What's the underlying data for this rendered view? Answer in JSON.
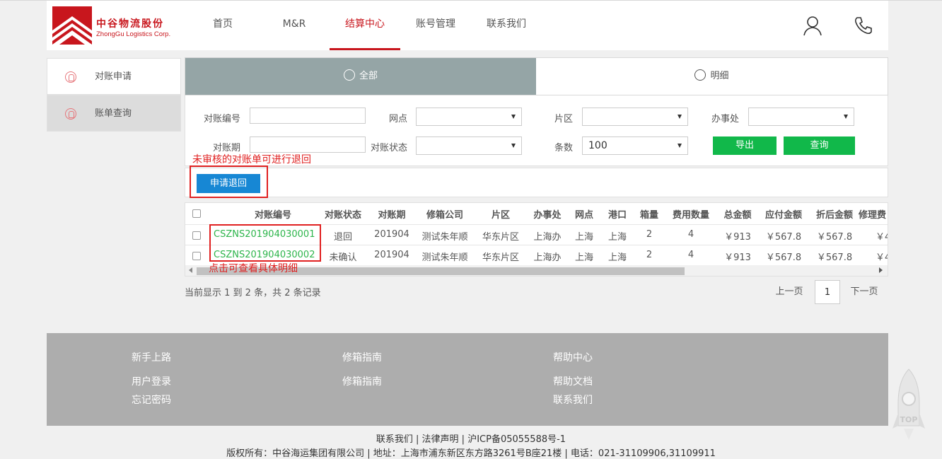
{
  "header": {
    "logo_cn": "中谷物流股份",
    "logo_en": "ZhongGu Logistics Corp.",
    "nav": [
      "首页",
      "M&R",
      "结算中心",
      "账号管理",
      "联系我们"
    ],
    "active_nav": "结算中心"
  },
  "sidebar": {
    "items": [
      {
        "label": "对账申请"
      },
      {
        "label": "账单查询"
      }
    ]
  },
  "tabs": {
    "all": "全部",
    "detail": "明细"
  },
  "filter": {
    "recon_no_label": "对账编号",
    "outlet_label": "网点",
    "area_label": "片区",
    "office_label": "办事处",
    "period_label": "对账期",
    "status_label": "对账状态",
    "rows_label": "条数",
    "rows_value": "100",
    "export_btn": "导出",
    "query_btn": "查询"
  },
  "annotations": {
    "return_note": "未审核的对账单可进行退回",
    "click_note": "点击可查看具体明细"
  },
  "actions": {
    "apply_return": "申请退回"
  },
  "table": {
    "headers": [
      "对账编号",
      "对账状态",
      "对账期",
      "修箱公司",
      "片区",
      "办事处",
      "网点",
      "港口",
      "箱量",
      "费用数量",
      "总金额",
      "应付金额",
      "折后金额",
      "修理费"
    ],
    "rows": [
      [
        "CSZNS201904030001",
        "退回",
        "201904",
        "测试朱年顺",
        "华东片区",
        "上海办",
        "上海",
        "上海",
        "2",
        "4",
        "￥913",
        "￥567.8",
        "￥567.8",
        "￥4"
      ],
      [
        "CSZNS201904030002",
        "未确认",
        "201904",
        "测试朱年顺",
        "华东片区",
        "上海办",
        "上海",
        "上海",
        "2",
        "4",
        "￥913",
        "￥567.8",
        "￥567.8",
        "￥4"
      ]
    ]
  },
  "pagination": {
    "status": "当前显示 1 到 2 条，共 2 条记录",
    "prev": "上一页",
    "page": "1",
    "next": "下一页"
  },
  "footer": {
    "col1": {
      "title": "新手上路",
      "links": [
        "用户登录",
        "忘记密码"
      ]
    },
    "col2": {
      "title": "修箱指南",
      "links": [
        "修箱指南"
      ]
    },
    "col3": {
      "title": "帮助中心",
      "links": [
        "帮助文档",
        "联系我们"
      ]
    },
    "line1": "联系我们 | 法律声明 | 沪ICP备05055588号-1",
    "line2": "版权所有：中谷海运集团有限公司 | 地址：上海市浦东新区东方路3261号B座21楼 | 电话：021-31109906,31109911"
  },
  "totop_label": "TOP",
  "colors": {
    "brand_red": "#c8161d",
    "green": "#11b84a",
    "blue": "#1787d4",
    "tab_active": "#95a5a6"
  }
}
